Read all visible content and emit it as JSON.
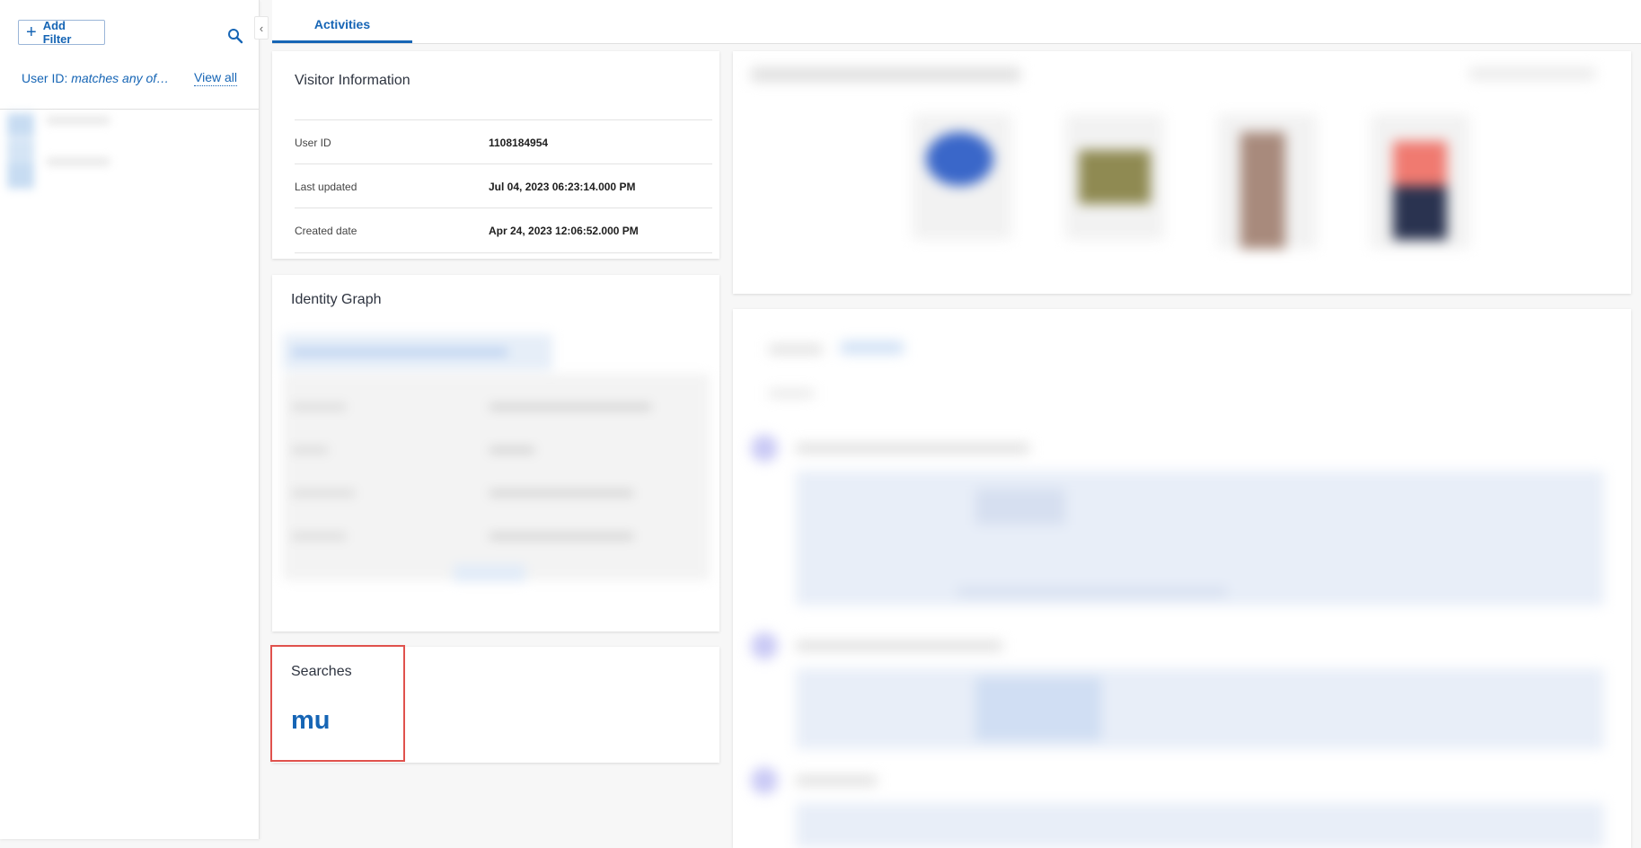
{
  "sidebar": {
    "add_filter_label": "Add Filter",
    "filter_key": "User ID:",
    "filter_value": "matches any of…",
    "view_all_label": "View all"
  },
  "tabs": [
    {
      "label": "Activities",
      "active": true
    }
  ],
  "visitor_info": {
    "title": "Visitor Information",
    "rows": [
      {
        "label": "User ID",
        "value": "1108184954"
      },
      {
        "label": "Last updated",
        "value": "Jul 04, 2023 06:23:14.000 PM"
      },
      {
        "label": "Created date",
        "value": "Apr 24, 2023 12:06:52.000 PM"
      }
    ]
  },
  "identity_graph": {
    "title": "Identity Graph"
  },
  "searches": {
    "title": "Searches",
    "terms": [
      "mu"
    ]
  },
  "colors": {
    "accent": "#1665b5",
    "highlight": "#e0524d"
  }
}
